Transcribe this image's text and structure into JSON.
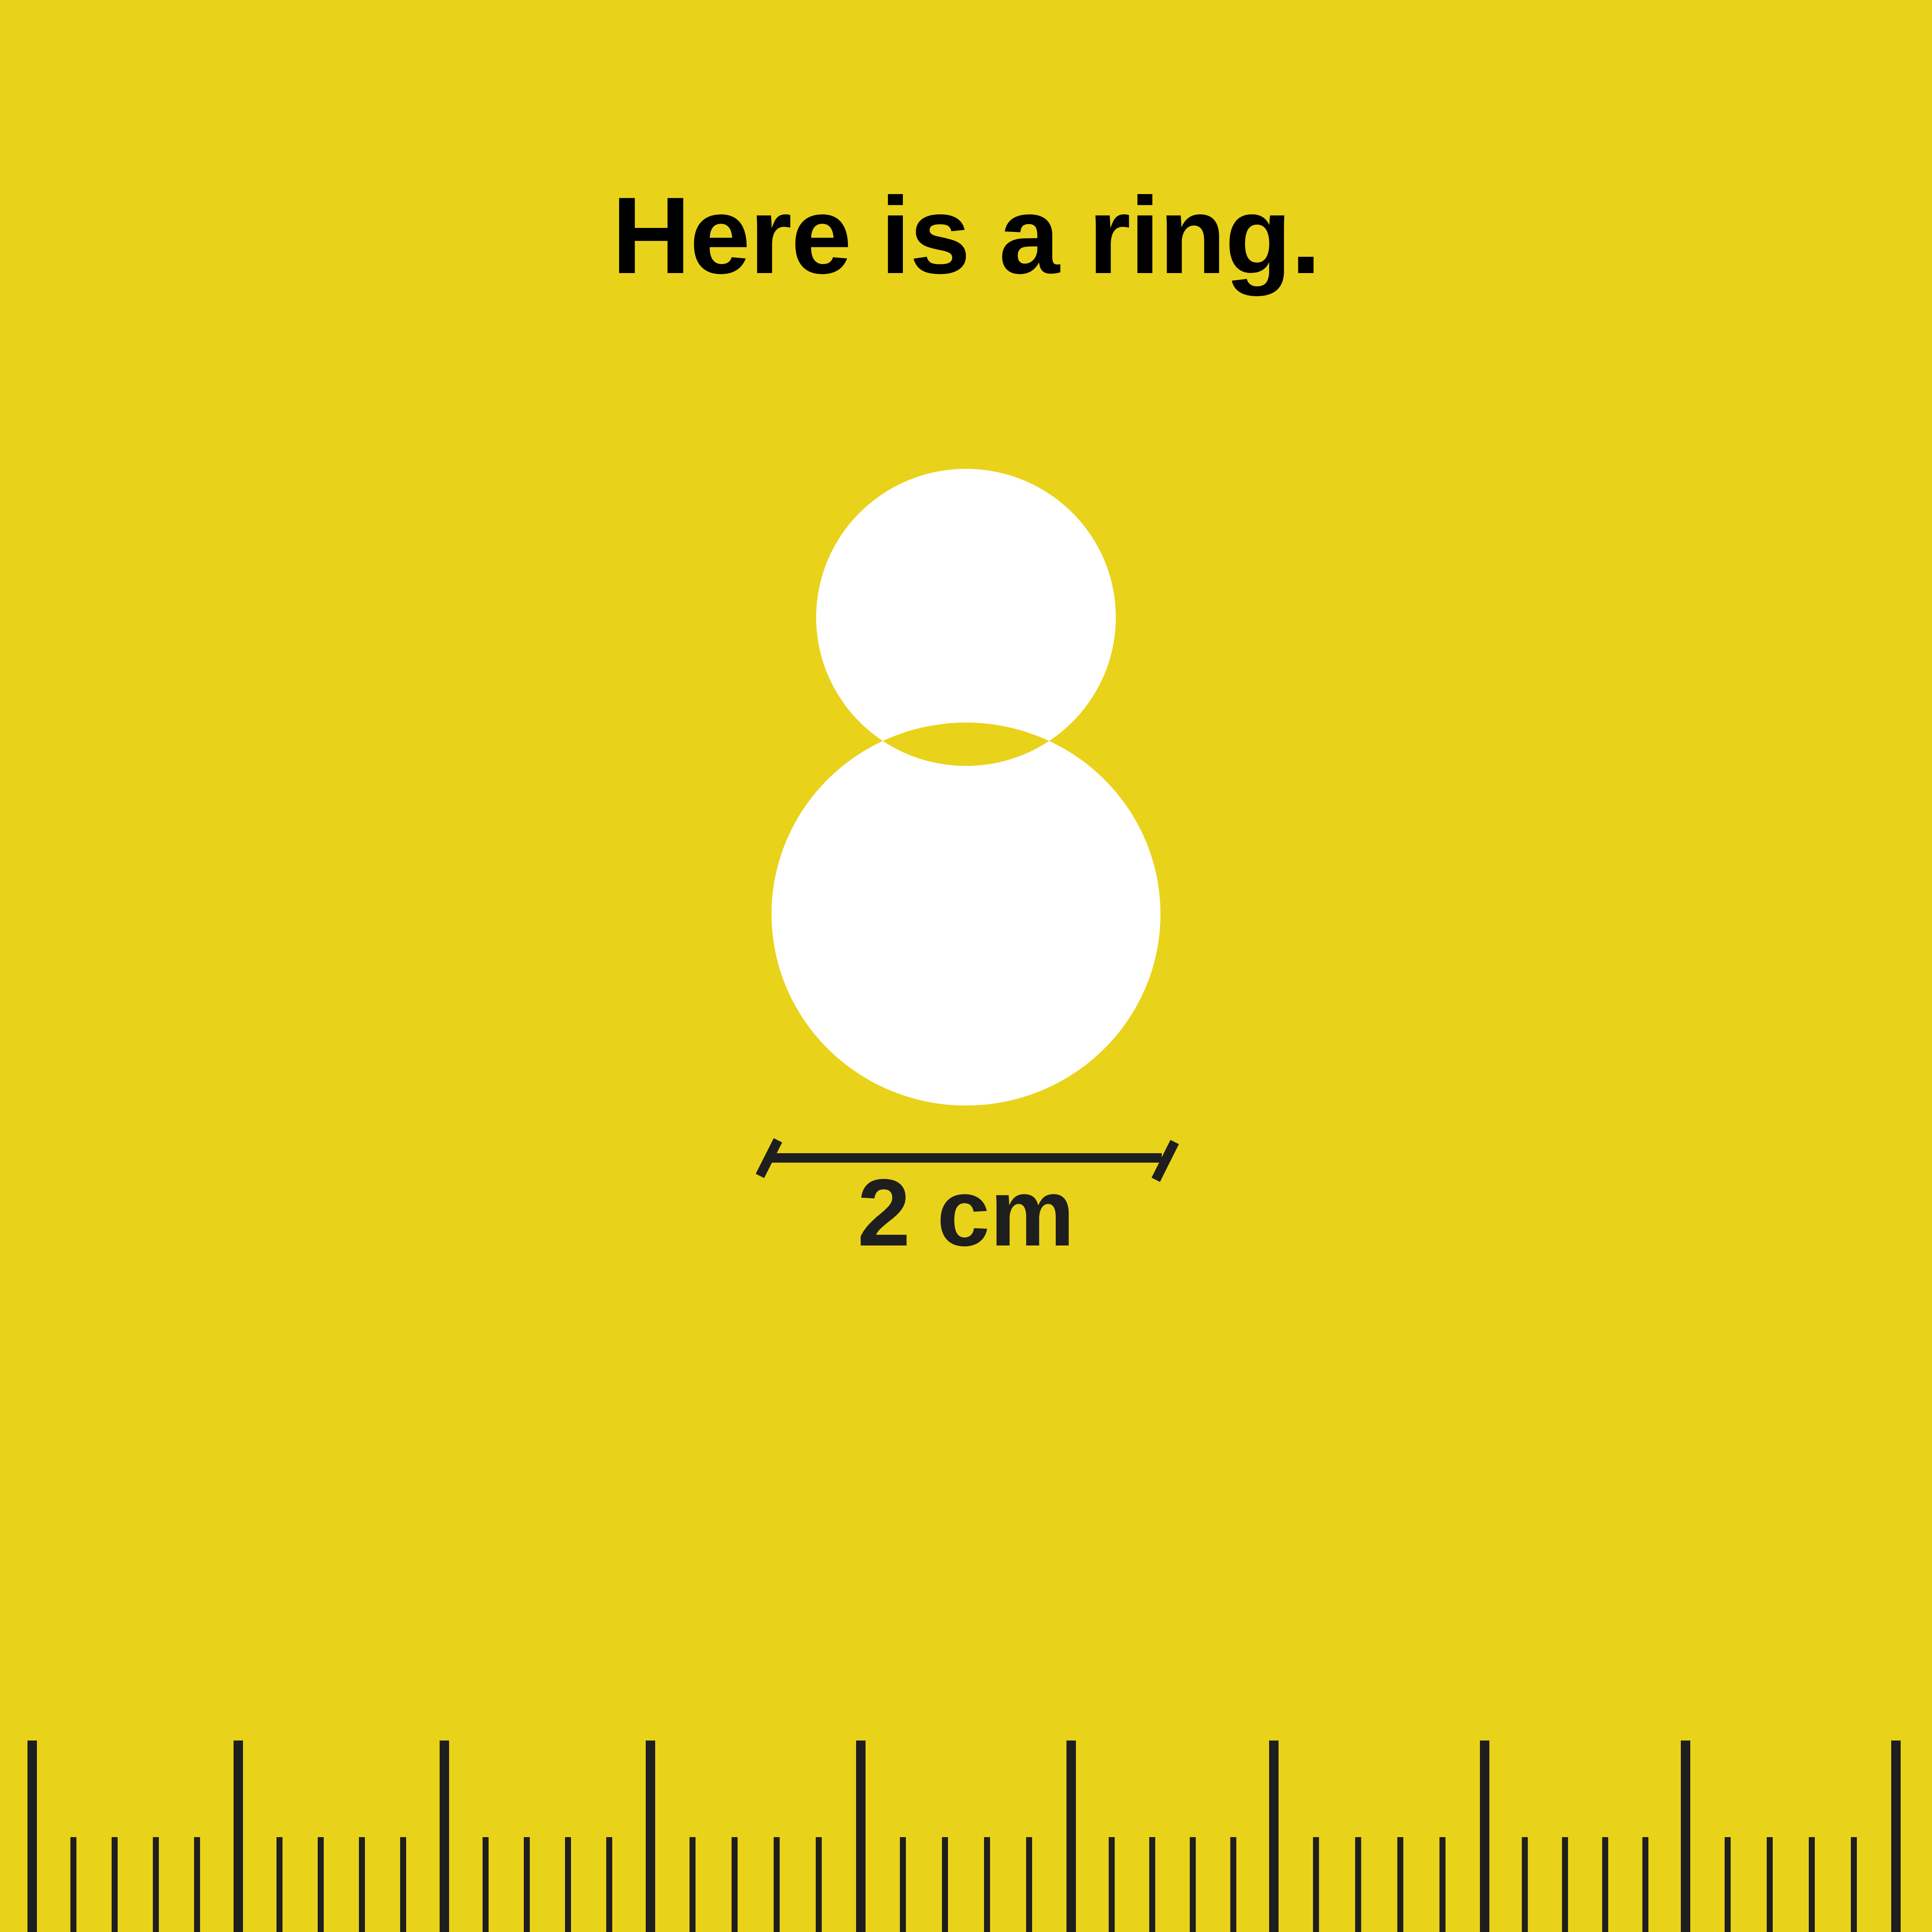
{
  "heading": {
    "text": "Here is a ring."
  },
  "measurement": {
    "label": "2 cm"
  },
  "ruler": {
    "major_every": 5,
    "tick_color": "#1E1E1E"
  },
  "colors": {
    "background": "#E9D21A",
    "ring": "#FFFFFF",
    "text": "#000000",
    "dimension": "#1E1E1E"
  },
  "icons": {
    "ring": "diamond-ring-icon",
    "dimension": "dimension-line-icon",
    "ruler": "ruler-icon"
  }
}
